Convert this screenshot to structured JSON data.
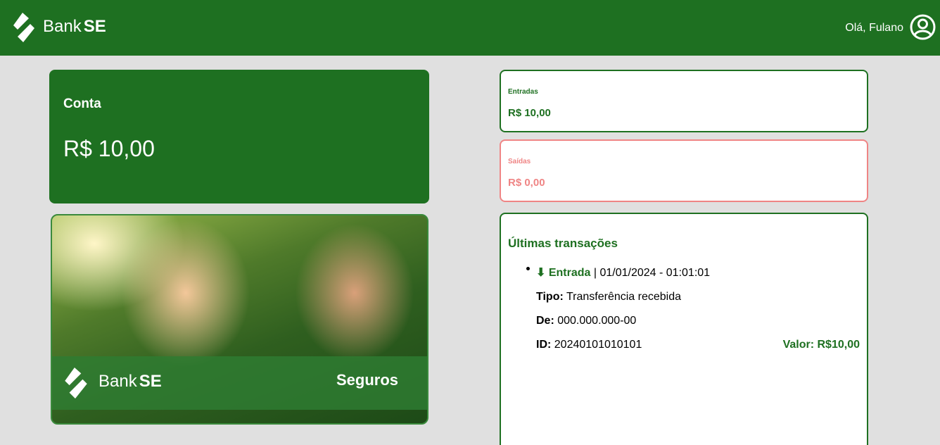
{
  "header": {
    "brand_prefix": "Bank",
    "brand_suffix": "SE",
    "greeting": "Olá, Fulano",
    "logo_icon": "bank-se-logo-icon",
    "user_icon": "user-circle-icon"
  },
  "account": {
    "title": "Conta",
    "balance": "R$ 10,00"
  },
  "promo": {
    "brand_prefix": "Bank",
    "brand_suffix": "SE",
    "tagline": "Seguros"
  },
  "summary": {
    "incoming": {
      "label": "Entradas",
      "value": "R$ 10,00"
    },
    "outgoing": {
      "label": "Saídas",
      "value": "R$ 0,00"
    }
  },
  "transactions": {
    "title": "Últimas transações",
    "items": [
      {
        "icon": "⬇",
        "type": "Entrada",
        "datetime": " | 01/01/2024 - 01:01:01",
        "tipo_label": "Tipo:",
        "tipo": " Transferência recebida",
        "de_label": "De:",
        "de": " 000.000.000-00",
        "id_label": "ID:",
        "id": " 20240101010101",
        "valor": "Valor: R$10,00"
      }
    ]
  },
  "colors": {
    "primary": "#1e7021",
    "negative": "#ef8585",
    "background": "#e0e0e0"
  }
}
